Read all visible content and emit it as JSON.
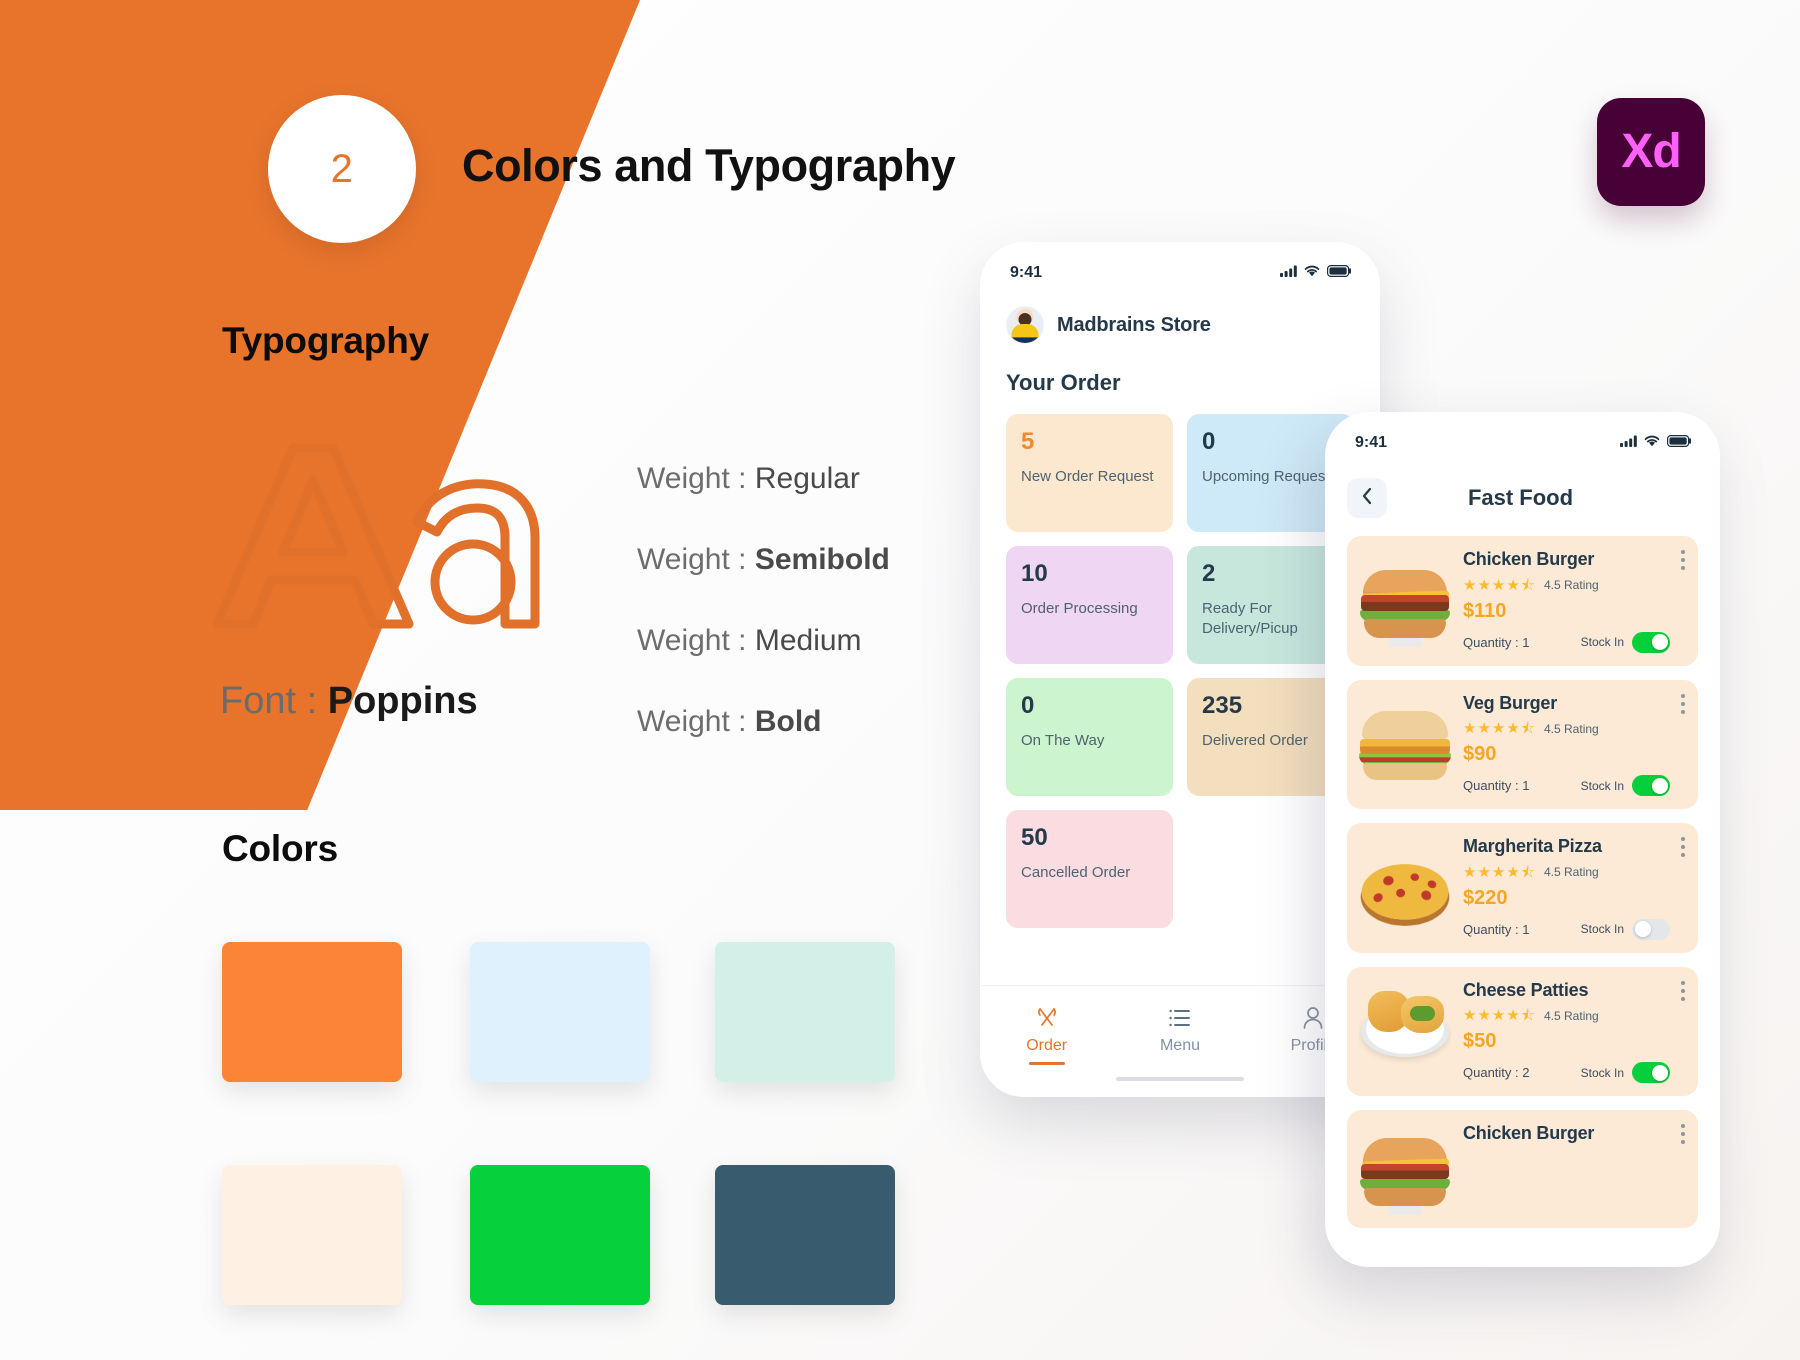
{
  "slide": {
    "step_number": "2",
    "title": "Colors and Typography",
    "logo_label": "Xd"
  },
  "typography": {
    "heading": "Typography",
    "specimen_glyphs": "Aa",
    "font_label_prefix": "Font : ",
    "font_name": "Poppins",
    "weights": [
      {
        "prefix": "Weight : ",
        "value": "Regular"
      },
      {
        "prefix": "Weight : ",
        "value": "Semibold"
      },
      {
        "prefix": "Weight : ",
        "value": "Medium"
      },
      {
        "prefix": "Weight : ",
        "value": "Bold"
      }
    ]
  },
  "colors": {
    "heading": "Colors",
    "swatches": [
      {
        "name": "primary-orange",
        "hex": "#FB8436"
      },
      {
        "name": "light-blue",
        "hex": "#DFF1FD"
      },
      {
        "name": "mint-green",
        "hex": "#D4EFE7"
      },
      {
        "name": "cream",
        "hex": "#FEF0E2"
      },
      {
        "name": "bright-green",
        "hex": "#06D13C"
      },
      {
        "name": "dark-navy",
        "hex": "#385B6E"
      }
    ]
  },
  "order_screen": {
    "status_bar": {
      "time": "9:41"
    },
    "store_name": "Madbrains Store",
    "section_title": "Your Order",
    "cards": [
      {
        "count": "5",
        "label": "New Order Request",
        "bg": "#FCE8CE",
        "num_color": "#F08A2E"
      },
      {
        "count": "0",
        "label": "Upcoming Request",
        "bg": "#CEE9F7",
        "num_color": "#24394a"
      },
      {
        "count": "10",
        "label": "Order Processing",
        "bg": "#EFD6F3",
        "num_color": "#24394a"
      },
      {
        "count": "2",
        "label": "Ready For Delivery/Picup",
        "bg": "#C7E7DD",
        "num_color": "#24394a"
      },
      {
        "count": "0",
        "label": "On The Way",
        "bg": "#CCF5CF",
        "num_color": "#24394a"
      },
      {
        "count": "235",
        "label": "Delivered Order",
        "bg": "#F3DEBD",
        "num_color": "#24394a"
      },
      {
        "count": "50",
        "label": "Cancelled Order",
        "bg": "#FBDCE0",
        "num_color": "#24394a"
      }
    ],
    "tabs": [
      {
        "label": "Order",
        "icon": "cutlery-icon",
        "active": true
      },
      {
        "label": "Menu",
        "icon": "list-icon",
        "active": false
      },
      {
        "label": "Profile",
        "icon": "user-icon",
        "active": false
      }
    ]
  },
  "food_screen": {
    "status_bar": {
      "time": "9:41"
    },
    "back_icon": "chevron-left-icon",
    "title": "Fast Food",
    "items": [
      {
        "name": "Chicken Burger",
        "stars": "★★★★",
        "half_star": "★",
        "rating_text": "4.5 Rating",
        "price": "$110",
        "quantity_label": "Quantity : 1",
        "stock_label": "Stock In",
        "in_stock": true,
        "thumb": "chicken-burger-image"
      },
      {
        "name": "Veg Burger",
        "stars": "★★★★",
        "half_star": "★",
        "rating_text": "4.5 Rating",
        "price": "$90",
        "quantity_label": "Quantity : 1",
        "stock_label": "Stock In",
        "in_stock": true,
        "thumb": "veg-burger-image"
      },
      {
        "name": "Margherita Pizza",
        "stars": "★★★★",
        "half_star": "★",
        "rating_text": "4.5 Rating",
        "price": "$220",
        "quantity_label": "Quantity : 1",
        "stock_label": "Stock In",
        "in_stock": false,
        "thumb": "margherita-pizza-image"
      },
      {
        "name": "Cheese Patties",
        "stars": "★★★★",
        "half_star": "★",
        "rating_text": "4.5 Rating",
        "price": "$50",
        "quantity_label": "Quantity : 2",
        "stock_label": "Stock In",
        "in_stock": true,
        "thumb": "cheese-patties-image"
      },
      {
        "name": "Chicken Burger",
        "stars": "",
        "half_star": "",
        "rating_text": "",
        "price": "",
        "quantity_label": "",
        "stock_label": "",
        "in_stock": true,
        "thumb": "chicken-burger-image"
      }
    ]
  }
}
